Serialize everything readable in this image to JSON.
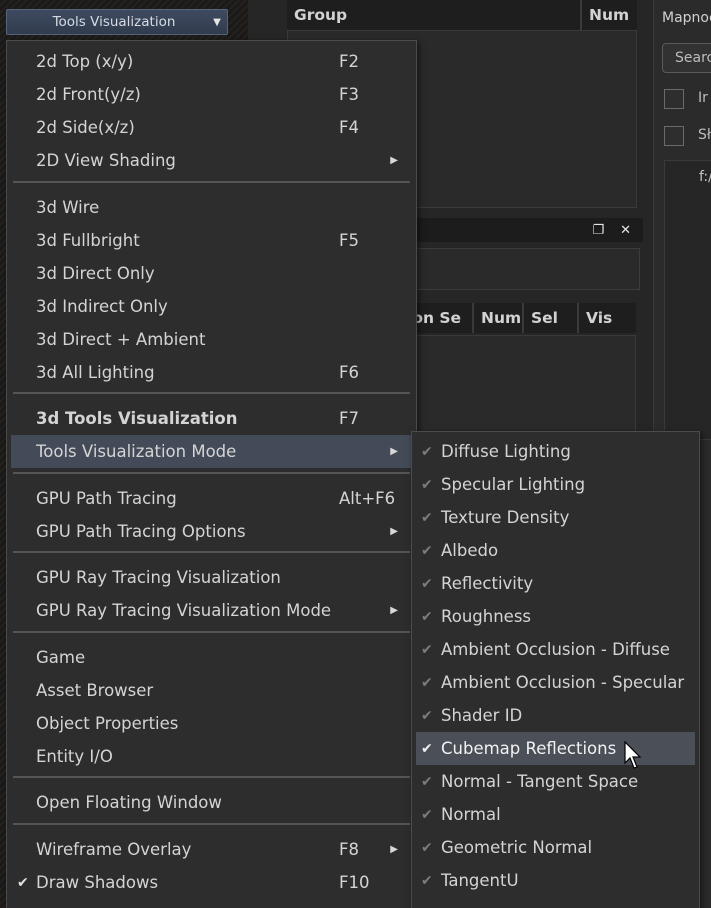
{
  "toolbar": {
    "visualization_dropdown": "Tools Visualization"
  },
  "mid_panel": {
    "top_grid_headers": [
      "Group",
      "Num"
    ],
    "bottom_grid_headers": [
      "ion Se",
      "Num",
      "Sel",
      "Vis"
    ]
  },
  "right_panel": {
    "title": "Mapnoc",
    "search_placeholder": "Searc",
    "check1_label": "Ir",
    "check2_label": "Sł",
    "tree_node": "f:/"
  },
  "main_menu": {
    "items": [
      {
        "label": "2d Top (x/y)",
        "shortcut": "F2"
      },
      {
        "label": "2d Front(y/z)",
        "shortcut": "F3"
      },
      {
        "label": "2d Side(x/z)",
        "shortcut": "F4"
      },
      {
        "label": "2D View Shading",
        "shortcut": ""
      },
      {
        "label": "3d Wire",
        "shortcut": ""
      },
      {
        "label": "3d Fullbright",
        "shortcut": "F5"
      },
      {
        "label": "3d Direct Only",
        "shortcut": ""
      },
      {
        "label": "3d Indirect Only",
        "shortcut": ""
      },
      {
        "label": "3d Direct + Ambient",
        "shortcut": ""
      },
      {
        "label": "3d All Lighting",
        "shortcut": "F6"
      },
      {
        "label": "3d Tools Visualization",
        "shortcut": "F7"
      },
      {
        "label": "Tools Visualization Mode",
        "shortcut": ""
      },
      {
        "label": "GPU Path Tracing",
        "shortcut": "Alt+F6"
      },
      {
        "label": "GPU Path Tracing Options",
        "shortcut": ""
      },
      {
        "label": "GPU Ray Tracing Visualization",
        "shortcut": ""
      },
      {
        "label": "GPU Ray Tracing Visualization Mode",
        "shortcut": ""
      },
      {
        "label": "Game",
        "shortcut": ""
      },
      {
        "label": "Asset Browser",
        "shortcut": ""
      },
      {
        "label": "Object Properties",
        "shortcut": ""
      },
      {
        "label": "Entity I/O",
        "shortcut": ""
      },
      {
        "label": "Open Floating Window",
        "shortcut": ""
      },
      {
        "label": "Wireframe Overlay",
        "shortcut": "F8"
      },
      {
        "label": "Draw Shadows",
        "shortcut": "F10"
      }
    ]
  },
  "sub_menu": {
    "items": [
      {
        "label": "Diffuse Lighting"
      },
      {
        "label": "Specular Lighting"
      },
      {
        "label": "Texture Density"
      },
      {
        "label": "Albedo"
      },
      {
        "label": "Reflectivity"
      },
      {
        "label": "Roughness"
      },
      {
        "label": "Ambient Occlusion - Diffuse"
      },
      {
        "label": "Ambient Occlusion - Specular"
      },
      {
        "label": "Shader ID"
      },
      {
        "label": "Cubemap Reflections"
      },
      {
        "label": "Normal - Tangent Space"
      },
      {
        "label": "Normal"
      },
      {
        "label": "Geometric Normal"
      },
      {
        "label": "TangentU"
      }
    ]
  },
  "colors": {
    "menu_bg": "#2d2d2d",
    "highlight": "#444b58",
    "dropdown_accent": "#3e4a5f"
  }
}
